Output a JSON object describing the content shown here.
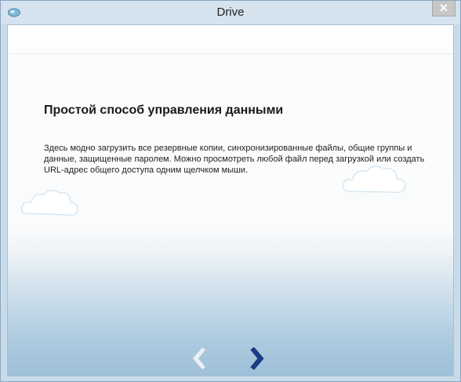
{
  "window": {
    "title": "Drive",
    "close_glyph": "✕"
  },
  "page": {
    "heading": "Простой способ управления данными",
    "description": "Здесь модно загрузить все резервные копии, синхронизированные файлы, общие группы и данные, защищенные паролем. Можно просмотреть любой файл перед загрузкой или создать URL-адрес общего доступа одним щелчком мыши."
  },
  "nav": {
    "prev_icon": "chevron-left-icon",
    "next_icon": "chevron-right-icon",
    "prev_color": "#e8eef3",
    "next_color": "#1b3f8e"
  }
}
